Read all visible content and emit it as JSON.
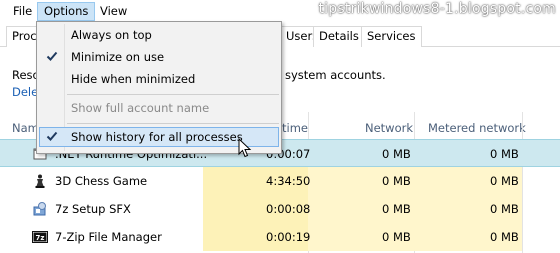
{
  "watermark": "tipstrikwindows8-1.blogspot.com",
  "menubar": {
    "file": "File",
    "options": "Options",
    "view": "View"
  },
  "options_menu": {
    "always_on_top": "Always on top",
    "minimize_on_use": "Minimize on use",
    "hide_when_minimized": "Hide when minimized",
    "show_full_account_name": "Show full account name",
    "show_history": "Show history for all processes",
    "checked": [
      "Minimize on use",
      "Show history for all processes"
    ]
  },
  "tabs": {
    "processes": "Proc",
    "users": "Users",
    "details": "Details",
    "services": "Services"
  },
  "info": {
    "text_left": "Reso",
    "text_right": "system accounts.",
    "link": "Dele"
  },
  "columns": {
    "name": "Name",
    "cpu_time": "time",
    "network": "Network",
    "metered_network": "Metered network"
  },
  "rows": [
    {
      "name": ".NET Runtime Optimizati...",
      "cpu_time": "0:00:07",
      "network": "0 MB",
      "metered": "0 MB",
      "icon": "dotnet-icon"
    },
    {
      "name": "3D Chess Game",
      "cpu_time": "4:34:50",
      "network": "0 MB",
      "metered": "0 MB",
      "icon": "chess-icon"
    },
    {
      "name": "7z Setup SFX",
      "cpu_time": "0:00:08",
      "network": "0 MB",
      "metered": "0 MB",
      "icon": "setup-icon"
    },
    {
      "name": "7-Zip File Manager",
      "cpu_time": "0:00:19",
      "network": "0 MB",
      "metered": "0 MB",
      "icon": "7zip-icon"
    }
  ],
  "colors": {
    "menu_highlight": "#cce4f7",
    "selected_row": "#cde8ef",
    "heat_cell": "#fdf2b8",
    "link": "#1a5fb4"
  }
}
